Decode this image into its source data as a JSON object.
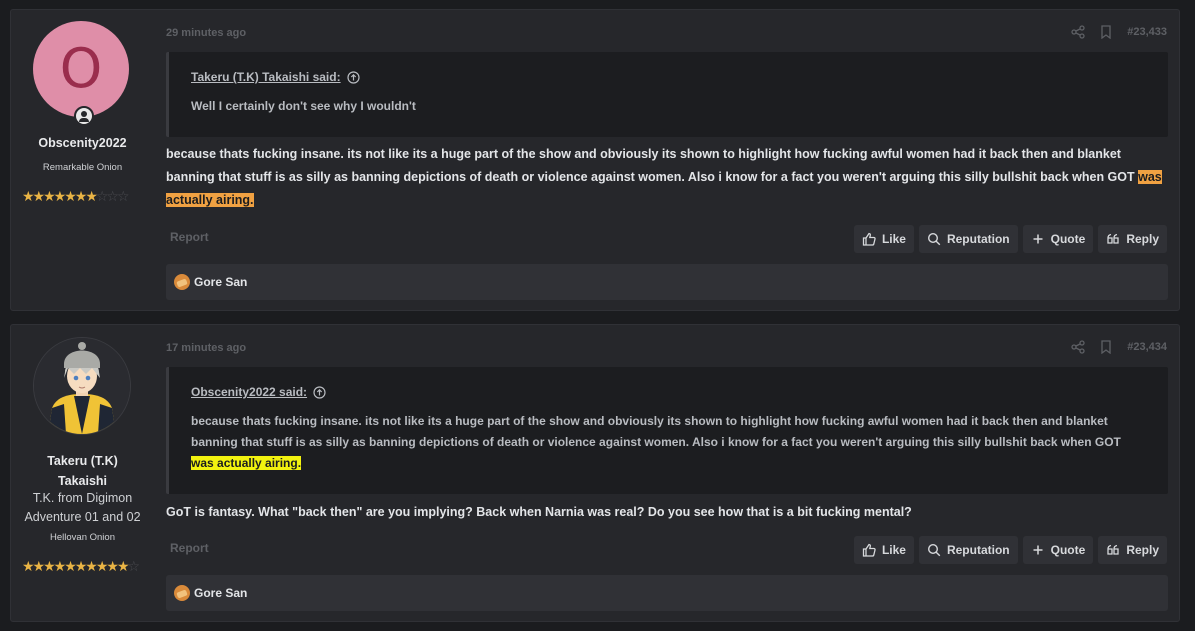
{
  "posts": [
    {
      "user": {
        "avatar_letter": "O",
        "username": "Obscenity2022",
        "title": "",
        "rank": "Remarkable Onion",
        "stars_full": 6,
        "stars_half": 1,
        "stars_total": 10
      },
      "time": "29 minutes ago",
      "post_number": "#23,433",
      "quote": {
        "author": "Takeru (T.K) Takaishi said:",
        "text": "Well I certainly don't see why I wouldn't"
      },
      "message_main": "because thats fucking insane. its not like its a huge part of the show and obviously its shown to highlight how fucking awful women had it back then and blanket banning that stuff is as silly as banning depictions of death or violence against women. Also i know for a fact you weren't arguing this silly bullshit back when GOT ",
      "message_highlight": "was actually airing.",
      "report": "Report",
      "actions": {
        "like": "Like",
        "reputation": "Reputation",
        "quote": "Quote",
        "reply": "Reply"
      },
      "liked_by": "Gore San"
    },
    {
      "user": {
        "username_line1": "Takeru (T.K)",
        "username_line2": "Takaishi",
        "title_line1": "T.K. from Digimon",
        "title_line2": "Adventure 01 and 02",
        "rank": "Hellovan Onion",
        "stars_full": 9,
        "stars_half": 1,
        "stars_total": 11
      },
      "time": "17 minutes ago",
      "post_number": "#23,434",
      "quote": {
        "author": "Obscenity2022 said:",
        "text": "because thats fucking insane. its not like its a huge part of the show and obviously its shown to highlight how fucking awful women had it back then and blanket banning that stuff is as silly as banning depictions of death or violence against women. Also i know for a fact you weren't arguing this silly bullshit back when GOT ",
        "highlight": "was actually airing."
      },
      "message": "GoT is fantasy. What \"back then\" are you implying? Back when Narnia was real? Do you see how that is a bit fucking mental?",
      "report": "Report",
      "actions": {
        "like": "Like",
        "reputation": "Reputation",
        "quote": "Quote",
        "reply": "Reply"
      },
      "liked_by": "Gore San"
    }
  ],
  "colors": {
    "accent_orange": "#f0a142",
    "accent_yellow": "#f2f20f",
    "star": "#e9b445"
  },
  "icons": [
    "share-icon",
    "bookmark-icon",
    "arrow-up-circle-icon",
    "thumbs-up-icon",
    "search-icon",
    "plus-icon",
    "quote-marks-icon",
    "reply-icon",
    "online-user-icon"
  ]
}
